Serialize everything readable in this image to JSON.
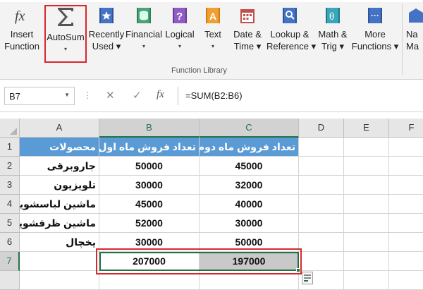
{
  "ribbon": {
    "buttons": [
      {
        "id": "insert-function",
        "line1": "Insert",
        "line2": "Function",
        "icon": "fx-icon"
      },
      {
        "id": "autosum",
        "line1": "AutoSum",
        "line2": "▾",
        "icon": "sigma-icon"
      },
      {
        "id": "recently-used",
        "line1": "Recently",
        "line2": "Used ▾",
        "icon": "star-book-icon"
      },
      {
        "id": "financial",
        "line1": "Financial",
        "line2": "▾",
        "icon": "coins-icon"
      },
      {
        "id": "logical",
        "line1": "Logical",
        "line2": "▾",
        "icon": "question-book-icon"
      },
      {
        "id": "text",
        "line1": "Text",
        "line2": "▾",
        "icon": "text-book-icon"
      },
      {
        "id": "date-time",
        "line1": "Date &",
        "line2": "Time ▾",
        "icon": "calendar-icon"
      },
      {
        "id": "lookup-reference",
        "line1": "Lookup &",
        "line2": "Reference ▾",
        "icon": "search-book-icon"
      },
      {
        "id": "math-trig",
        "line1": "Math &",
        "line2": "Trig ▾",
        "icon": "theta-book-icon"
      },
      {
        "id": "more-functions",
        "line1": "More",
        "line2": "Functions ▾",
        "icon": "more-book-icon"
      },
      {
        "id": "name-manager",
        "line1": "Na",
        "line2": "Ma",
        "icon": "tag-icon"
      }
    ],
    "group_label": "Function Library"
  },
  "formula_bar": {
    "name_box": "B7",
    "cancel_icon": "✕",
    "enter_icon": "✓",
    "fx_label": "fx",
    "formula": "=SUM(B2:B6)"
  },
  "columns": [
    "A",
    "B",
    "C",
    "D",
    "E",
    "F"
  ],
  "rows": [
    "1",
    "2",
    "3",
    "4",
    "5",
    "6",
    "7"
  ],
  "sheet": {
    "headers": {
      "A1": "محصولات",
      "B1": "تعداد فروش ماه اول",
      "C1": "تعداد فروش ماه دوم"
    },
    "products": [
      "جاروبرقی",
      "تلویزیون",
      "ماشین لباسشویی",
      "ماشین ظرفشویی",
      "یخچال"
    ],
    "month1": [
      "50000",
      "30000",
      "45000",
      "52000",
      "30000"
    ],
    "month2": [
      "45000",
      "32000",
      "40000",
      "30000",
      "50000"
    ],
    "totals": {
      "B7": "207000",
      "C7": "197000"
    }
  },
  "colors": {
    "header_fill": "#5b9bd5",
    "selection": "#217346",
    "highlight": "#d9272e"
  }
}
